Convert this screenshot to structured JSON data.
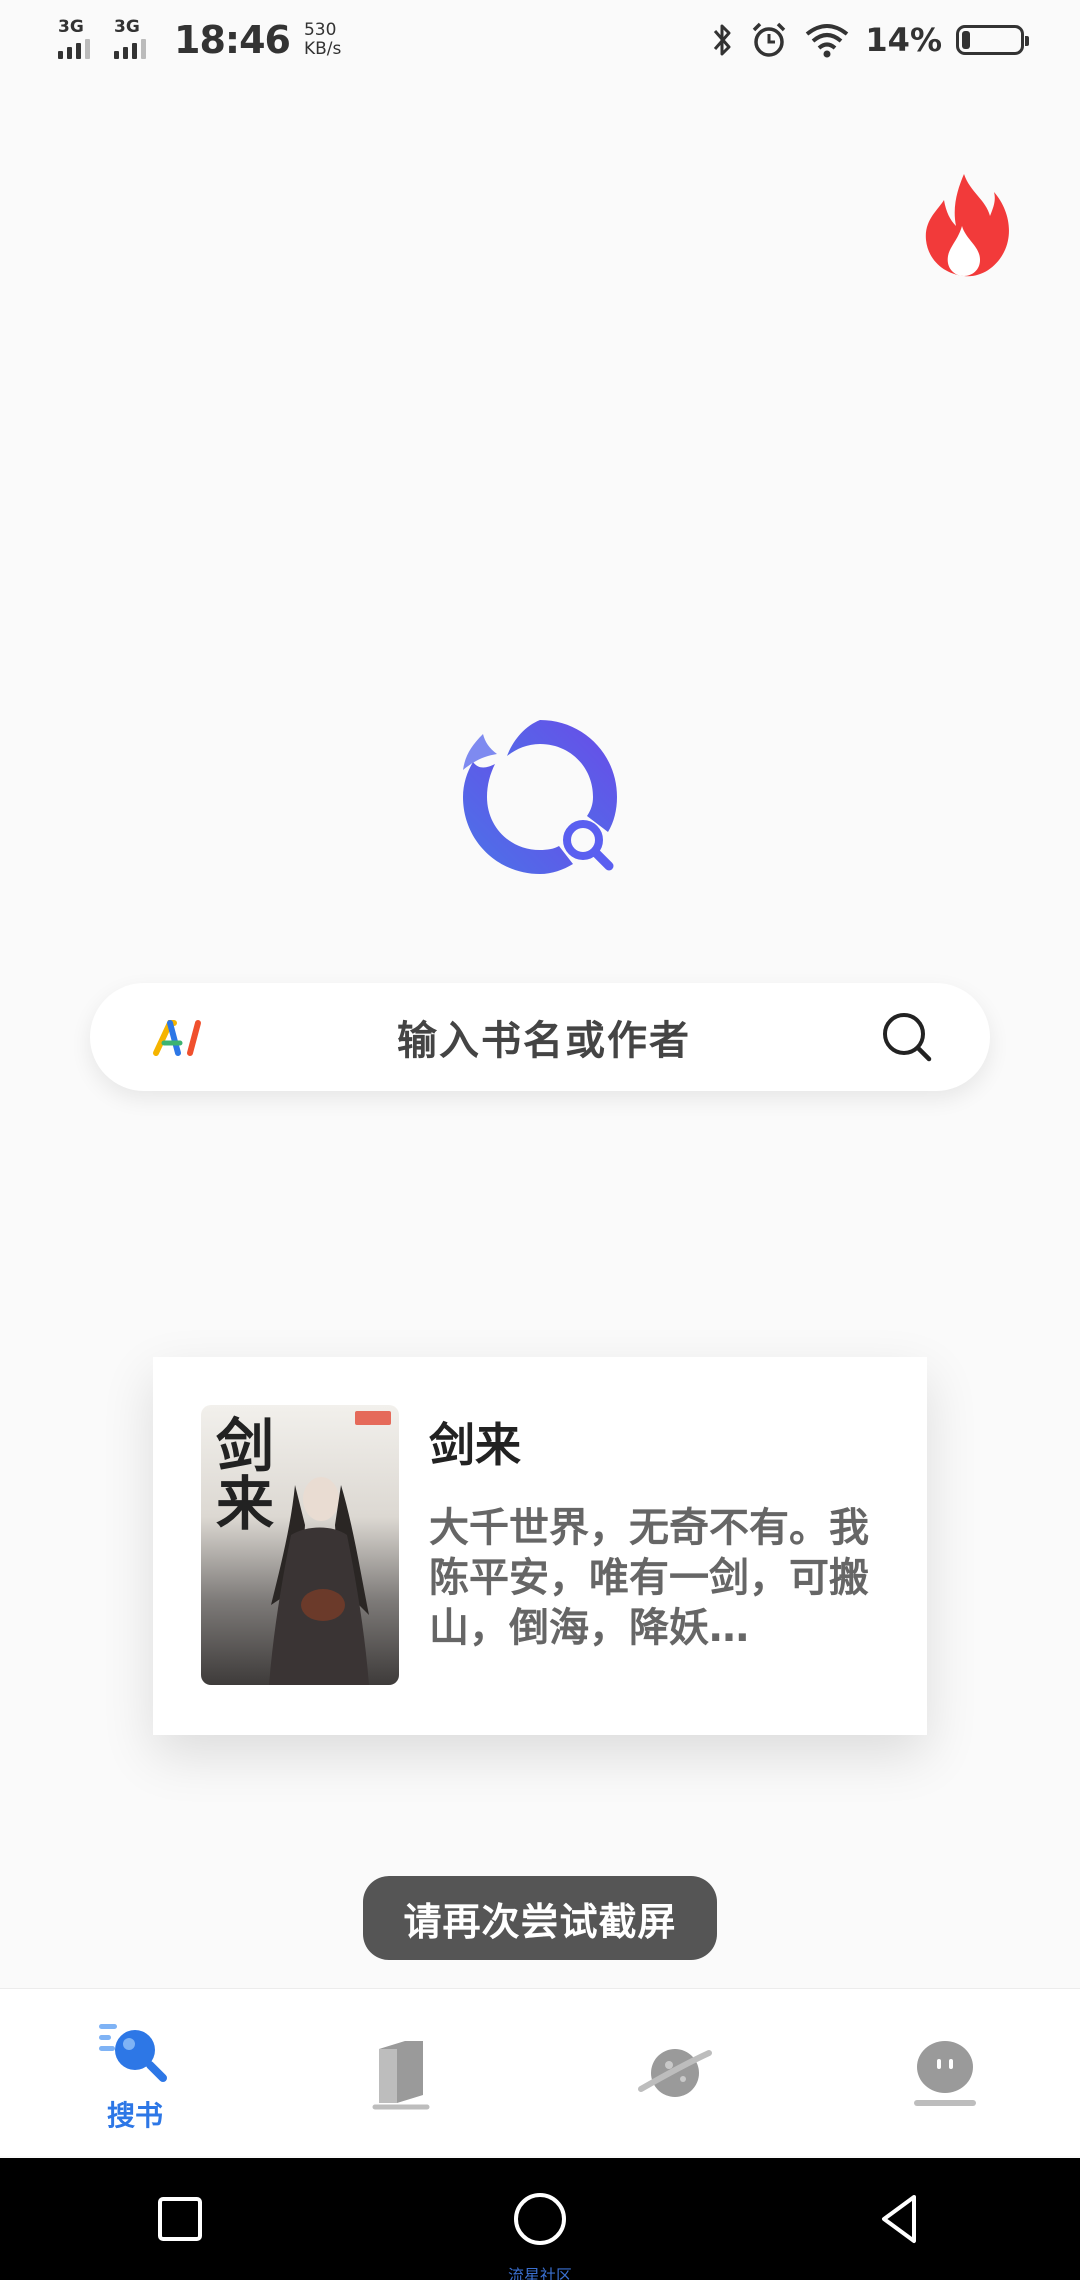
{
  "status_bar": {
    "network_1": "3G",
    "network_2": "3G",
    "time": "18:46",
    "speed_value": "530",
    "speed_unit": "KB/s",
    "battery_percent": "14%"
  },
  "search": {
    "ai_badge": "AI",
    "placeholder": "输入书名或作者"
  },
  "book_card": {
    "title": "剑来",
    "cover_text": "剑来",
    "description": "大千世界，无奇不有。我陈平安，唯有一剑，可搬山，倒海，降妖…"
  },
  "toast": {
    "text": "请再次尝试截屏"
  },
  "tabbar": {
    "tabs": [
      {
        "label": "搜书",
        "icon": "search-books-icon",
        "active": true
      },
      {
        "label": "",
        "icon": "bookshelf-icon",
        "active": false
      },
      {
        "label": "",
        "icon": "planet-icon",
        "active": false
      },
      {
        "label": "",
        "icon": "profile-icon",
        "active": false
      }
    ],
    "active_color": "#2d77e6",
    "inactive_color": "#9a9a9a"
  },
  "navbar": {
    "buttons": [
      "recents-button",
      "home-button",
      "back-button"
    ],
    "watermark": "流星社区"
  },
  "colors": {
    "accent": "#5b5cf0",
    "flame": "#f23a3a",
    "toast_bg": "#555555"
  }
}
